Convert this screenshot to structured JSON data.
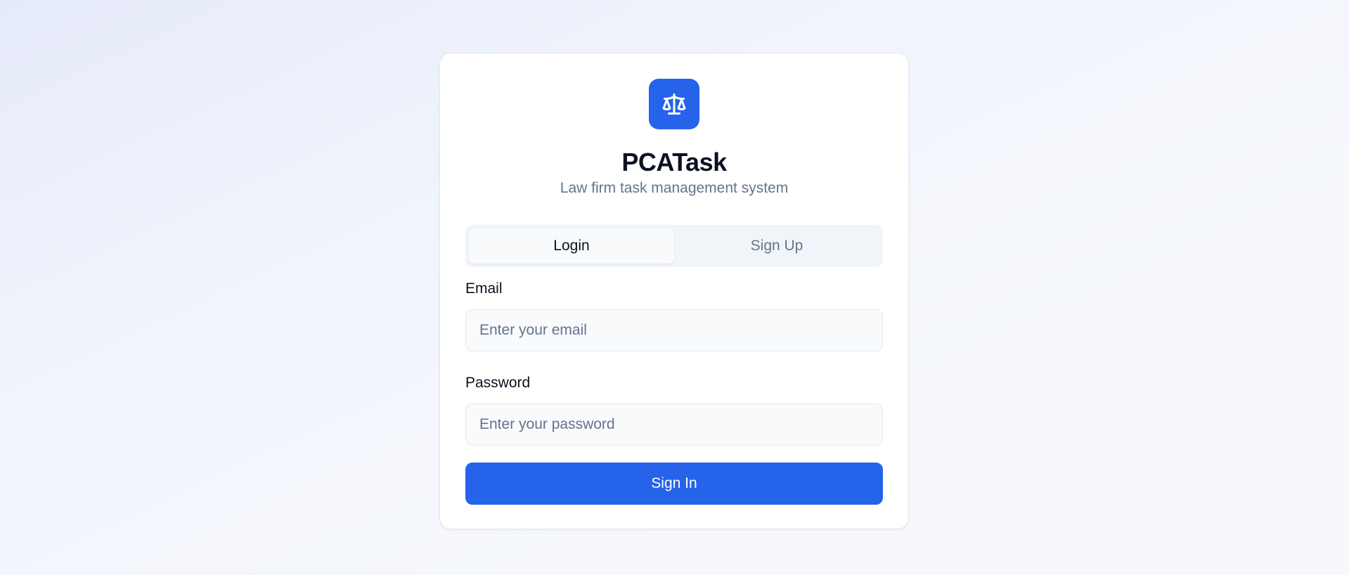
{
  "app": {
    "title": "PCATask",
    "subtitle": "Law firm task management system",
    "logo_icon": "scale-icon"
  },
  "tabs": [
    {
      "label": "Login",
      "active": true
    },
    {
      "label": "Sign Up",
      "active": false
    }
  ],
  "form": {
    "email": {
      "label": "Email",
      "placeholder": "Enter your email",
      "value": ""
    },
    "password": {
      "label": "Password",
      "placeholder": "Enter your password",
      "value": ""
    },
    "submit_label": "Sign In"
  },
  "colors": {
    "accent": "#2563eb",
    "text_primary": "#0b1220",
    "text_muted": "#64748b"
  }
}
